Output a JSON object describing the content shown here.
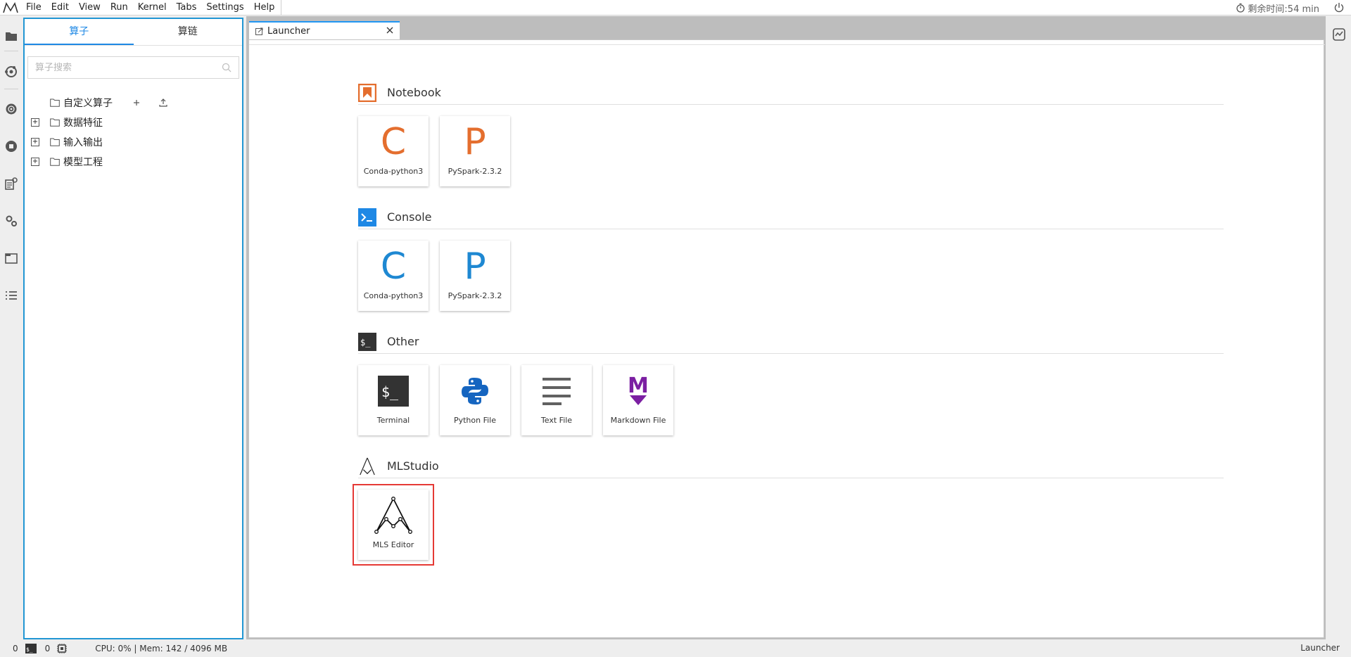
{
  "menubar": {
    "items": [
      "File",
      "Edit",
      "View",
      "Run",
      "Kernel",
      "Tabs",
      "Settings",
      "Help"
    ],
    "timer": "剩余时间:54 min"
  },
  "sidepanel": {
    "tabs": [
      "算子",
      "算链"
    ],
    "active_tab": "算子",
    "search": {
      "placeholder": "算子搜索",
      "value": ""
    },
    "tree": [
      {
        "label": "自定义算子",
        "expandable": false,
        "actions": [
          "+",
          "upload"
        ]
      },
      {
        "label": "数据特征",
        "expandable": true
      },
      {
        "label": "输入输出",
        "expandable": true
      },
      {
        "label": "模型工程",
        "expandable": true
      }
    ]
  },
  "tab": {
    "label": "Launcher"
  },
  "launcher": {
    "sections": [
      {
        "title": "Notebook",
        "cards": [
          {
            "label": "Conda-python3",
            "letter": "C",
            "color": "#E46E2E"
          },
          {
            "label": "PySpark-2.3.2",
            "letter": "P",
            "color": "#E46E2E"
          }
        ]
      },
      {
        "title": "Console",
        "cards": [
          {
            "label": "Conda-python3",
            "letter": "C",
            "color": "#1E88D2"
          },
          {
            "label": "PySpark-2.3.2",
            "letter": "P",
            "color": "#1E88D2"
          }
        ]
      },
      {
        "title": "Other",
        "cards": [
          {
            "label": "Terminal",
            "icon": "terminal-icon"
          },
          {
            "label": "Python File",
            "icon": "python-icon"
          },
          {
            "label": "Text File",
            "icon": "text-file-icon"
          },
          {
            "label": "Markdown File",
            "icon": "markdown-icon"
          }
        ]
      },
      {
        "title": "MLStudio",
        "cards": [
          {
            "label": "MLS Editor",
            "icon": "mls-icon",
            "selected": true
          }
        ]
      }
    ]
  },
  "statusbar": {
    "terminals": "0",
    "kernels": "0",
    "resources": "CPU: 0% | Mem: 142 / 4096 MB",
    "right_label": "Launcher"
  },
  "colors": {
    "accent": "#2196D3",
    "notebook": "#E46E2E",
    "console": "#1E88D2",
    "selection": "#E53935",
    "markdown": "#7B1FA2"
  }
}
